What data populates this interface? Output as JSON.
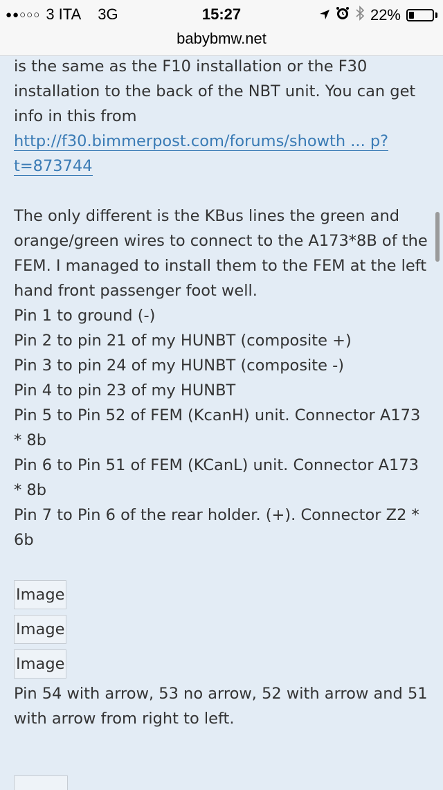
{
  "status_bar": {
    "carrier": "3 ITA",
    "network": "3G",
    "time": "15:27",
    "battery": "22%",
    "battery_level": 0.22,
    "icons": [
      "signal-dots-icon",
      "location-arrow-icon",
      "alarm-icon",
      "bluetooth-icon",
      "battery-icon"
    ]
  },
  "browser": {
    "url": "babybmw.net"
  },
  "post": {
    "para1_text": "is the same as the F10 installation or the F30 installation to the back of the NBT unit. You can get info in this from",
    "link_text": "http://f30.bimmerpost.com/forums/showth ... p?t=873744",
    "para2_text": "The only different is the KBus lines the green and orange/green wires to connect to the A173*8B of the FEM. I managed to install them to the FEM at the left hand front passenger foot well.",
    "pins": [
      "Pin 1 to ground (-)",
      "Pin 2 to pin 21 of my HUNBT (composite +)",
      "Pin 3 to pin 24 of my HUNBT (composite -)",
      "Pin 4 to pin 23 of my HUNBT",
      "Pin 5 to Pin 52 of FEM (KcanH) unit. Connector A173 * 8b",
      "Pin 6 to Pin 51 of FEM (KCanL) unit. Connector A173 * 8b",
      "Pin 7 to Pin 6 of the rear holder. (+). Connector Z2 * 6b"
    ],
    "images": [
      "Image",
      "Image",
      "Image"
    ],
    "para3_text": "Pin 54 with arrow, 53 no arrow, 52 with arrow and 51 with arrow from right to left."
  },
  "colors": {
    "background": "#e3ecf5",
    "text": "#333333",
    "link": "#3a7bb5"
  }
}
